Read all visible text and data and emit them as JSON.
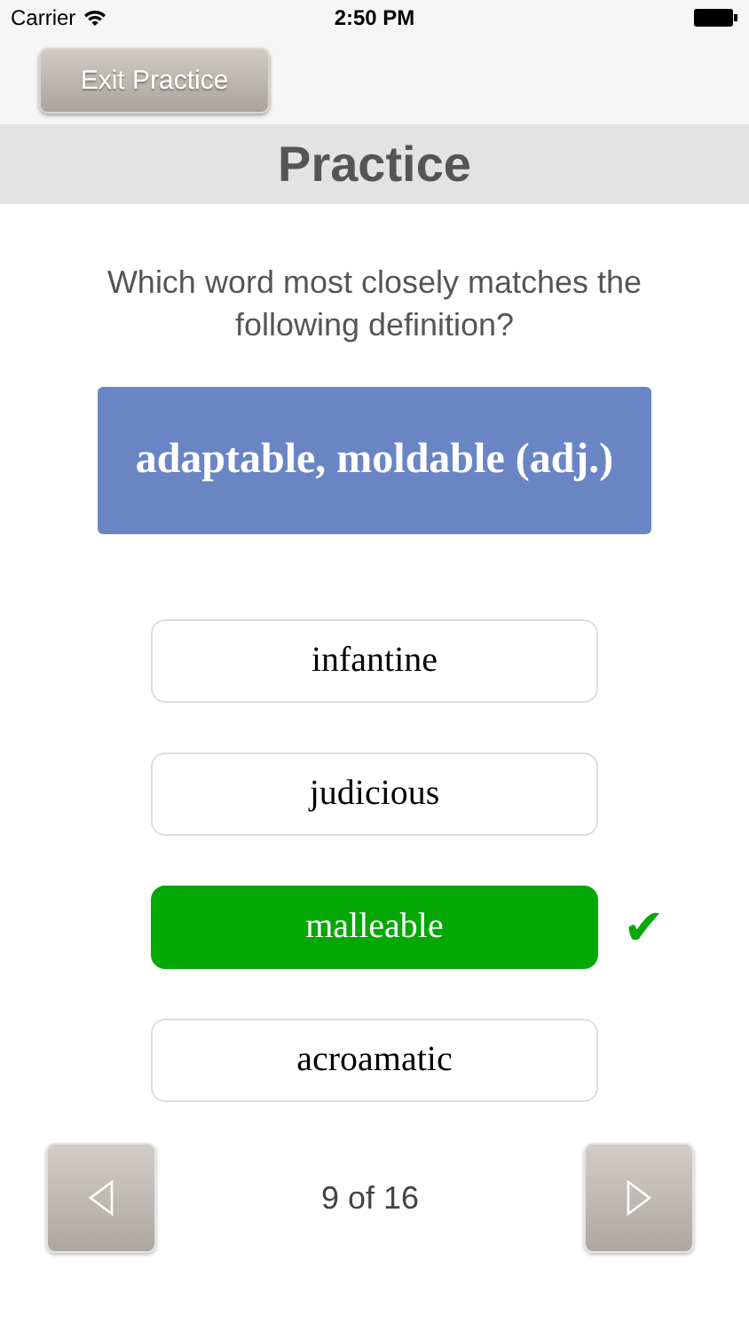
{
  "status_bar": {
    "carrier": "Carrier",
    "time": "2:50 PM"
  },
  "toolbar": {
    "exit_button": "Exit Practice"
  },
  "title": "Practice",
  "question": "Which word most closely matches the following definition?",
  "definition": "adaptable, moldable (adj.)",
  "options": [
    {
      "label": "infantine",
      "selected": false,
      "correct": false
    },
    {
      "label": "judicious",
      "selected": false,
      "correct": false
    },
    {
      "label": "malleable",
      "selected": true,
      "correct": true
    },
    {
      "label": "acroamatic",
      "selected": false,
      "correct": false
    }
  ],
  "correct_mark": "✔",
  "pager": {
    "position": "9 of 16"
  }
}
